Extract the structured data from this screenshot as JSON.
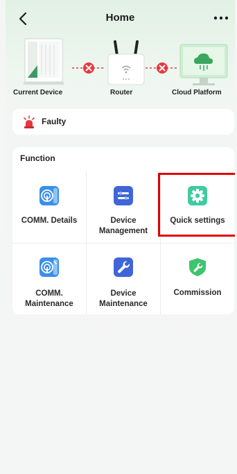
{
  "header": {
    "title": "Home"
  },
  "topology": {
    "current_device_label": "Current Device",
    "router_label": "Router",
    "cloud_label": "Cloud Platform",
    "link_status_color": "#e8373f"
  },
  "status": {
    "label": "Faulty",
    "icon": "alarm-light-icon"
  },
  "function": {
    "title": "Function",
    "items": [
      {
        "line1": "COMM. Details",
        "line2": "",
        "icon": "signal-tower-icon",
        "color": "#3b8fe9"
      },
      {
        "line1": "Device",
        "line2": "Management",
        "icon": "sliders-icon",
        "color": "#3f66d8"
      },
      {
        "line1": "Quick settings",
        "line2": "",
        "icon": "gear-icon",
        "color": "#3ecb9f"
      },
      {
        "line1": "COMM.",
        "line2": "Maintenance",
        "icon": "signal-wrench-icon",
        "color": "#3b8fe9"
      },
      {
        "line1": "Device",
        "line2": "Maintenance",
        "icon": "wrench-icon",
        "color": "#3f66d8"
      },
      {
        "line1": "Commission",
        "line2": "",
        "icon": "shield-wrench-icon",
        "color": "#3ec46f"
      }
    ]
  },
  "highlight": {
    "target": "Quick settings",
    "color": "#e10000"
  }
}
